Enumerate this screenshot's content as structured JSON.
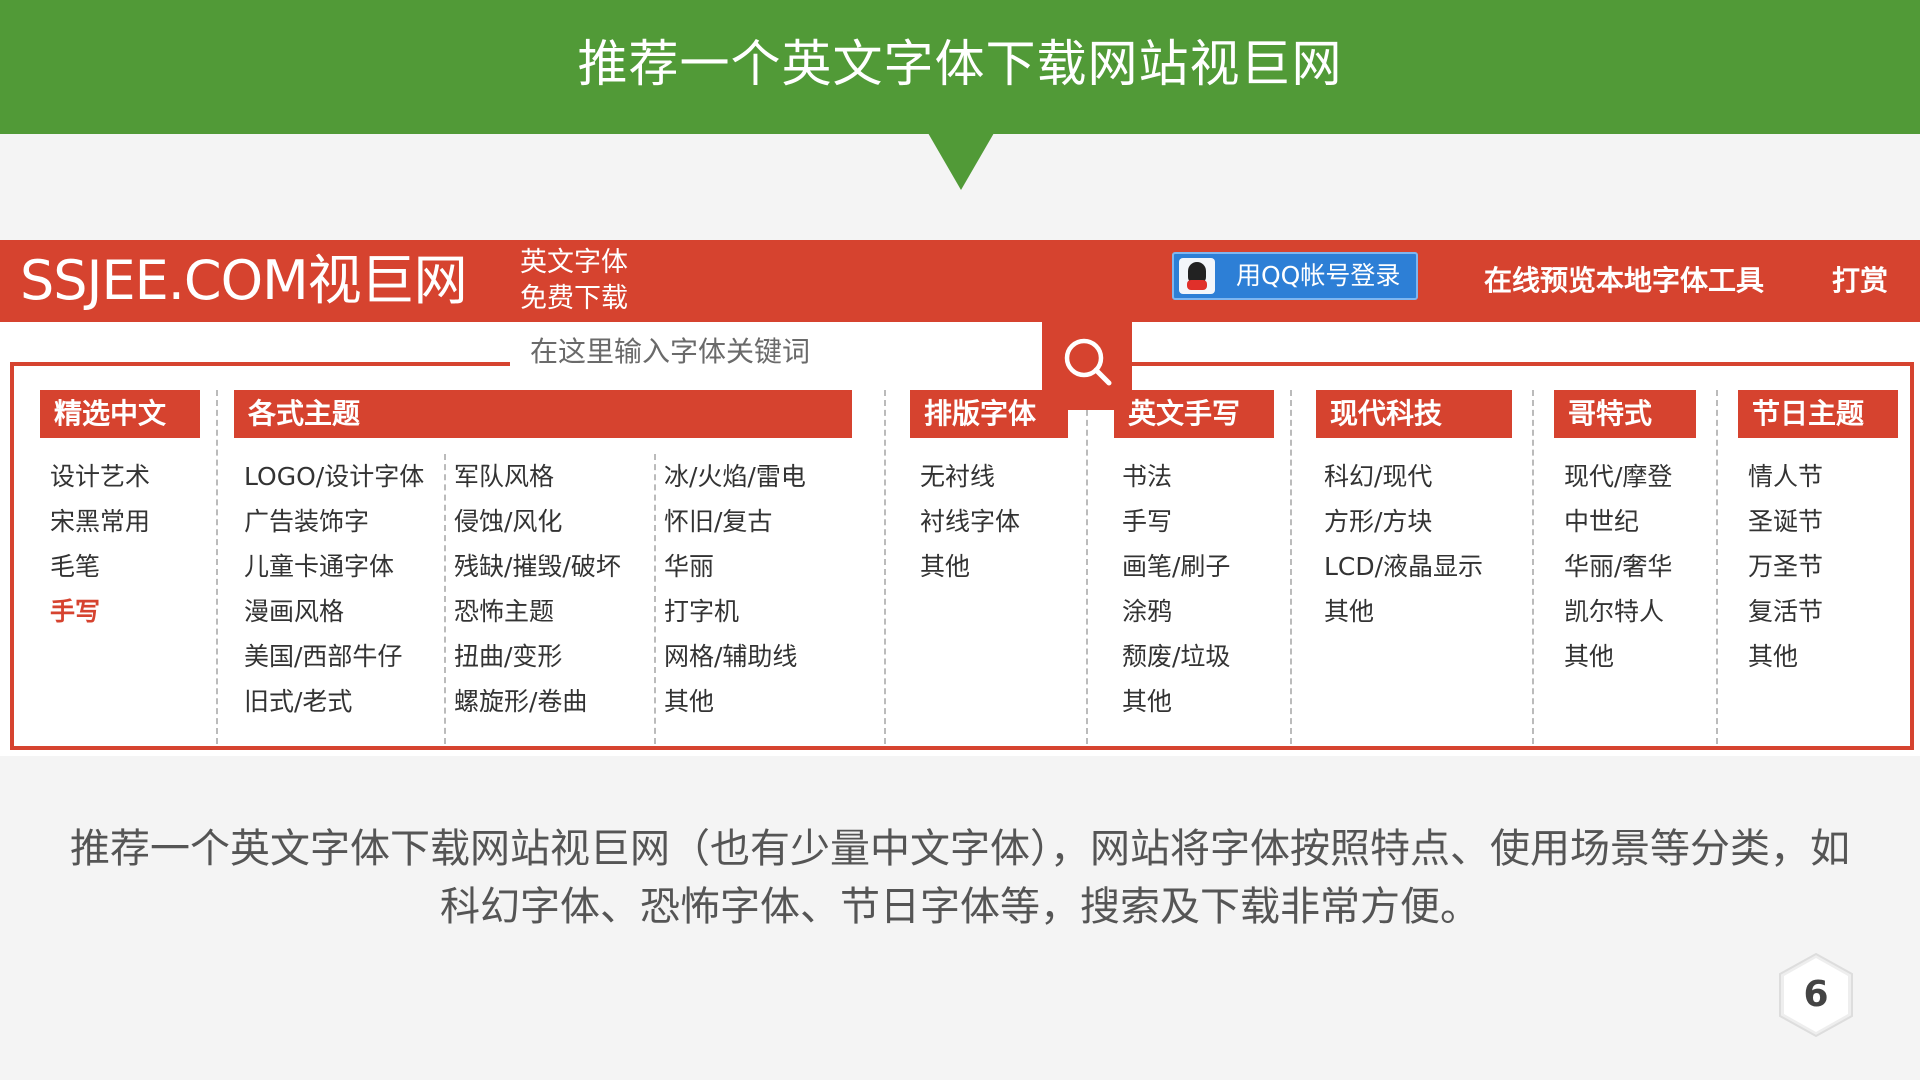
{
  "slide": {
    "title": "推荐一个英文字体下载网站视巨网",
    "caption_line1": "推荐一个英文字体下载网站视巨网（也有少量中文字体），网站将字体按照特点、使用场景等分类，如",
    "caption_line2": "科幻字体、恐怖字体、节日字体等，搜索及下载非常方便。",
    "page_number": "6",
    "accent_color": "#519a37"
  },
  "site": {
    "logo": "SSJEE.COM视巨网",
    "tagline_line1": "英文字体",
    "tagline_line2": "免费下载",
    "qq_login": "用QQ帐号登录",
    "preview_tool": "在线预览本地字体工具",
    "reward": "打赏",
    "search_placeholder": "在这里输入字体关键词",
    "brand_color": "#d6432f"
  },
  "categories": [
    {
      "title": "精选中文",
      "items": [
        "设计艺术",
        "宋黑常用",
        "毛笔",
        "手写"
      ],
      "active": "手写"
    },
    {
      "title": "各式主题",
      "items_a": [
        "LOGO/设计字体",
        "广告装饰字",
        "儿童卡通字体",
        "漫画风格",
        "美国/西部牛仔",
        "旧式/老式"
      ],
      "items_b": [
        "军队风格",
        "侵蚀/风化",
        "残缺/摧毁/破坏",
        "恐怖主题",
        "扭曲/变形",
        "螺旋形/卷曲"
      ],
      "items_c": [
        "冰/火焰/雷电",
        "怀旧/复古",
        "华丽",
        "打字机",
        "网格/辅助线",
        "其他"
      ]
    },
    {
      "title": "排版字体",
      "items": [
        "无衬线",
        "衬线字体",
        "其他"
      ]
    },
    {
      "title": "英文手写",
      "items": [
        "书法",
        "手写",
        "画笔/刷子",
        "涂鸦",
        "颓废/垃圾",
        "其他"
      ]
    },
    {
      "title": "现代科技",
      "items": [
        "科幻/现代",
        "方形/方块",
        "LCD/液晶显示",
        "其他"
      ]
    },
    {
      "title": "哥特式",
      "items": [
        "现代/摩登",
        "中世纪",
        "华丽/奢华",
        "凯尔特人",
        "其他"
      ]
    },
    {
      "title": "节日主题",
      "items": [
        "情人节",
        "圣诞节",
        "万圣节",
        "复活节",
        "其他"
      ]
    }
  ]
}
